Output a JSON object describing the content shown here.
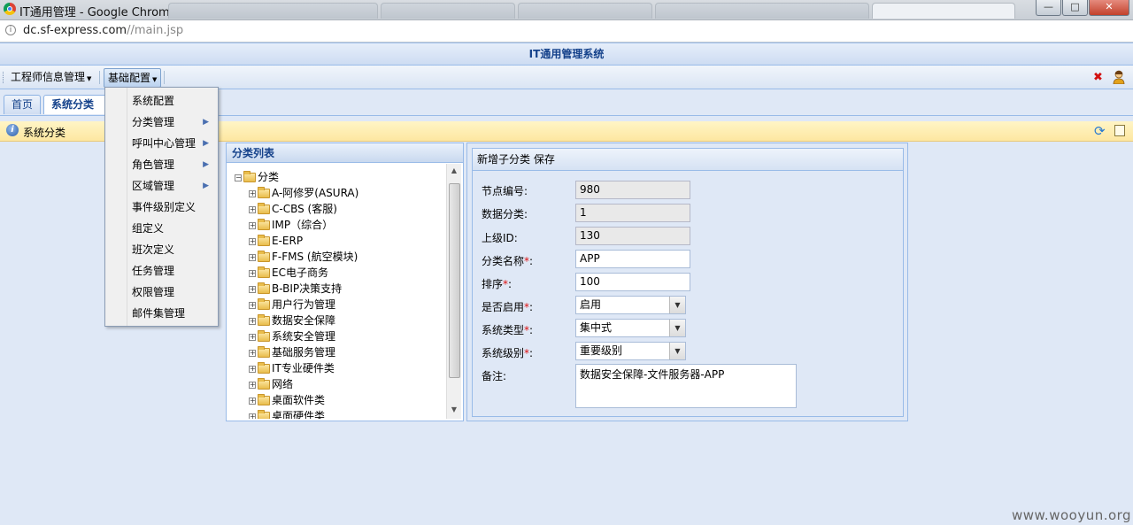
{
  "browser": {
    "window_title": "IT通用管理 - Google Chrome",
    "url_host": "dc.sf-express.com",
    "url_path": "//main.jsp",
    "controls": {
      "minimize": "—",
      "maximize": "□",
      "close": "✕"
    }
  },
  "app": {
    "title": "IT通用管理系统"
  },
  "menubar": {
    "engineer_info": "工程师信息管理",
    "basic_config": "基础配置"
  },
  "dropdown": {
    "items": [
      {
        "label": "系统配置",
        "has_sub": false
      },
      {
        "label": "分类管理",
        "has_sub": true
      },
      {
        "label": "呼叫中心管理",
        "has_sub": true
      },
      {
        "label": "角色管理",
        "has_sub": true
      },
      {
        "label": "区域管理",
        "has_sub": true
      },
      {
        "label": "事件级别定义",
        "has_sub": false
      },
      {
        "label": "组定义",
        "has_sub": false
      },
      {
        "label": "班次定义",
        "has_sub": false
      },
      {
        "label": "任务管理",
        "has_sub": false
      },
      {
        "label": "权限管理",
        "has_sub": false
      },
      {
        "label": "邮件集管理",
        "has_sub": false
      }
    ]
  },
  "tabs": {
    "home": "首页",
    "system_category": "系统分类"
  },
  "infobar": {
    "text": "系统分类"
  },
  "tree": {
    "title": "分类列表",
    "root": "分类",
    "nodes": [
      "A-阿修罗(ASURA)",
      "C-CBS (客服)",
      "IMP（综合）",
      "E-ERP",
      "F-FMS (航空模块)",
      "EC电子商务",
      "B-BIP决策支持",
      "用户行为管理",
      "数据安全保障",
      "系统安全管理",
      "基础服务管理",
      "IT专业硬件类",
      "网络",
      "桌面软件类",
      "桌面硬件类"
    ]
  },
  "form": {
    "toolbar": "新增子分类  保存",
    "fields": {
      "node_no": {
        "label": "节点编号:",
        "value": "980"
      },
      "data_category": {
        "label": "数据分类:",
        "value": "1"
      },
      "parent_id": {
        "label": "上级ID:",
        "value": "130"
      },
      "category_name": {
        "label": "分类名称",
        "value": "APP"
      },
      "sort": {
        "label": "排序",
        "value": "100"
      },
      "enabled": {
        "label": "是否启用",
        "value": "启用"
      },
      "system_type": {
        "label": "系统类型",
        "value": "集中式"
      },
      "system_level": {
        "label": "系统级别",
        "value": "重要级别"
      },
      "remark": {
        "label": "备注:",
        "value": "数据安全保障-文件服务器-APP"
      }
    },
    "required_mark": "*",
    "colon": ":"
  },
  "watermark": "www.wooyun.org"
}
